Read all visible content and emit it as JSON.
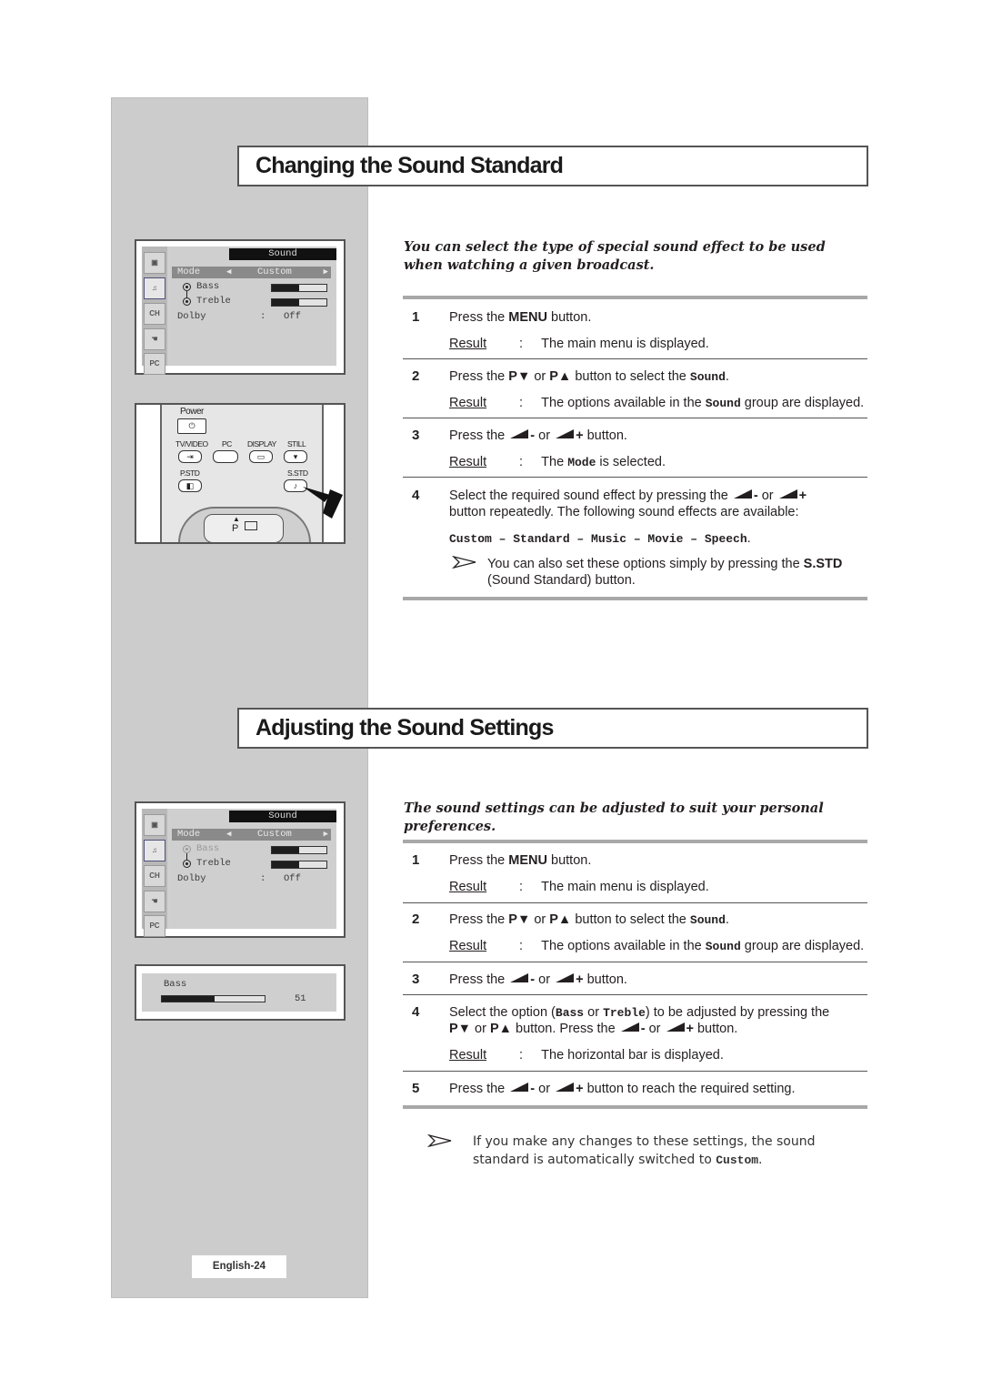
{
  "sections": [
    {
      "title": "Changing the Sound Standard",
      "intro": "You can select the type of special sound effect to be used when watching a given broadcast.",
      "steps": [
        {
          "num": "1",
          "text_before": "Press the ",
          "bold": "MENU",
          "text_after": " button.",
          "result_label": "Result",
          "result": "The main menu is displayed."
        },
        {
          "num": "2",
          "text_before": "Press the ",
          "bold1": "P▼",
          "mid": " or ",
          "bold2": "P▲",
          "text_after": " button to select the ",
          "mono": "Sound",
          "end": ".",
          "result_label": "Result",
          "result_before": "The options available in the ",
          "result_mono": "Sound",
          "result_after": " group are displayed."
        },
        {
          "num": "3",
          "text_before": "Press the ",
          "minus": "-",
          "or": " or ",
          "plus": "+",
          "text_after": " button.",
          "result_label": "Result",
          "result_before": "The ",
          "result_mono": "Mode",
          "result_after": " is selected."
        },
        {
          "num": "4",
          "text_before": "Select the required sound effect by pressing the ",
          "minus": "-",
          "or": " or ",
          "plus": "+",
          "text_after": "button repeatedly. The following sound effects are available:",
          "effects": "Custom – Standard – Music – Movie – Speech",
          "effects_end": ".",
          "note_before": "You can also set these options simply by pressing the ",
          "note_bold": "S.STD",
          "note_after": "(Sound Standard) button."
        }
      ]
    },
    {
      "title": "Adjusting the Sound Settings",
      "intro": "The sound settings can be adjusted to suit your personal preferences.",
      "steps": [
        {
          "num": "1",
          "text_before": "Press the ",
          "bold": "MENU",
          "text_after": " button.",
          "result_label": "Result",
          "result": "The main menu is displayed."
        },
        {
          "num": "2",
          "text_before": "Press the ",
          "bold1": "P▼",
          "mid": " or ",
          "bold2": "P▲",
          "text_after": " button to select the ",
          "mono": "Sound",
          "end": ".",
          "result_label": "Result",
          "result_before": "The options available in the ",
          "result_mono": "Sound",
          "result_after": " group are displayed."
        },
        {
          "num": "3",
          "text_before": "Press the ",
          "minus": "-",
          "or": " or ",
          "plus": "+",
          "text_after": " button."
        },
        {
          "num": "4",
          "text_before": "Select the option (",
          "mono1": "Bass",
          "or_text": " or ",
          "mono2": "Treble",
          "text_mid": ") to be adjusted by pressing the",
          "bold1": "P▼",
          "mid": " or ",
          "bold2": "P▲",
          "text_after": " button. Press the ",
          "minus": "-",
          "or": " or ",
          "plus": "+",
          "end": " button.",
          "result_label": "Result",
          "result": "The horizontal bar is displayed."
        },
        {
          "num": "5",
          "text_before": "Press the ",
          "minus": "-",
          "or": " or ",
          "plus": "+",
          "text_after": " button to reach the required setting."
        }
      ],
      "note_before": "If you make any changes to these settings, the sound standard is automatically switched to ",
      "note_mono": "Custom",
      "note_end": "."
    }
  ],
  "osd_menu": {
    "header": "Sound",
    "mode_label": "Mode",
    "mode_value": "Custom",
    "left_arrow": "◀",
    "right_arrow": "▶",
    "bass_label": "Bass",
    "treble_label": "Treble",
    "bass_level": 0.5,
    "treble_level": 0.5,
    "dolby_label": "Dolby",
    "dolby_sep": ":",
    "dolby_value": "Off",
    "icons": [
      "picture-icon",
      "sound-icon",
      "channel-icon",
      "function-icon",
      "pc-icon"
    ],
    "icon_labels": [
      "",
      "",
      "CH",
      "",
      "PC"
    ]
  },
  "bass_popup": {
    "label": "Bass",
    "value": "51",
    "level": 0.51
  },
  "remote": {
    "power_label": "Power",
    "power_symbol": "⏻",
    "tvvideo_label": "TV/VIDEO",
    "pc_label": "PC",
    "display_label": "DISPLAY",
    "still_label": "STILL",
    "pstd_label": "P.STD",
    "sstd_label": "S.STD",
    "p_label": "P",
    "p_up": "▲"
  },
  "footer": {
    "page_label": "English-24"
  }
}
